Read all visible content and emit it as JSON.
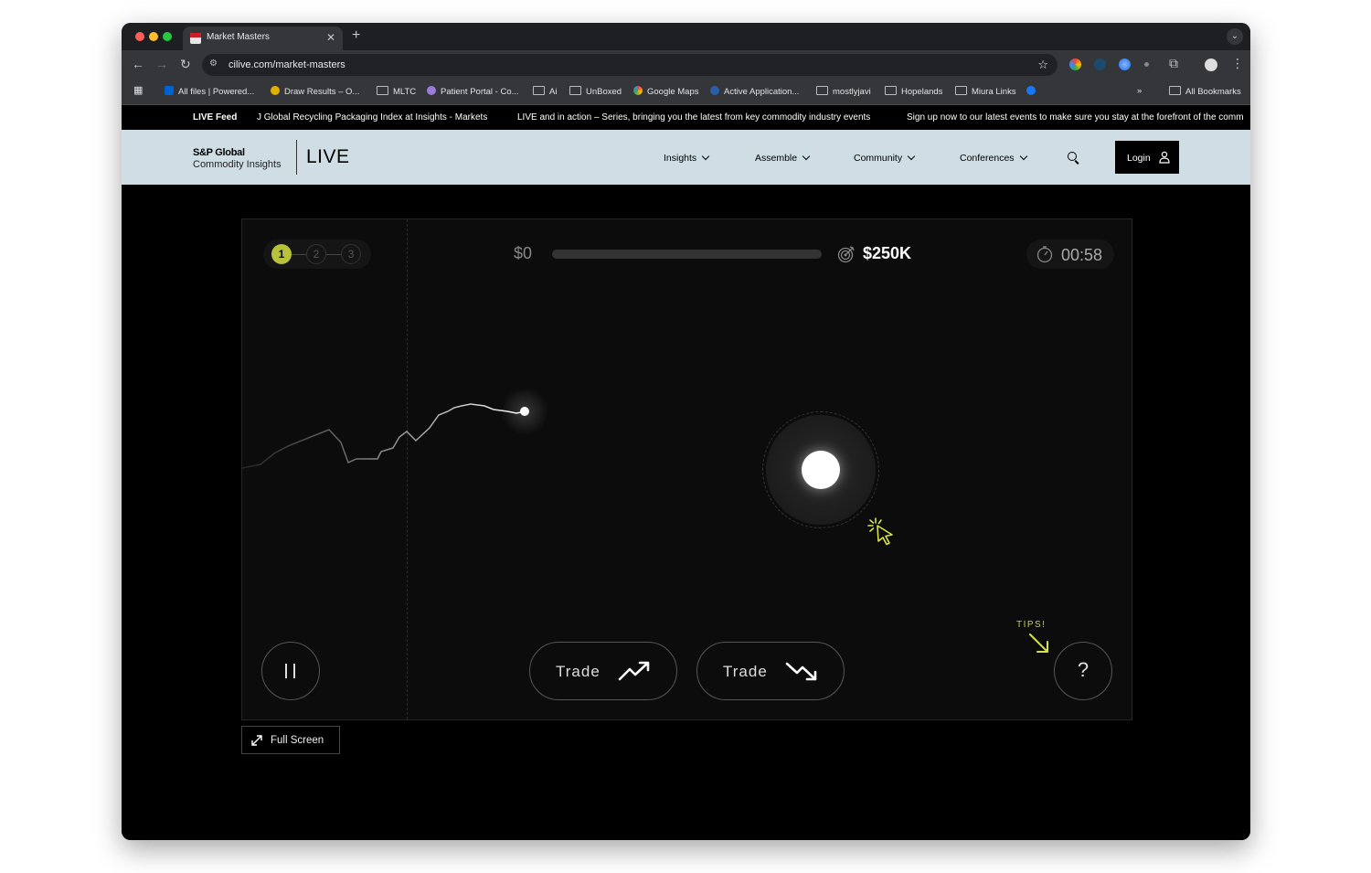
{
  "browser": {
    "tab_title": "Market Masters",
    "url": "cilive.com/market-masters",
    "bookmarks": [
      "All files | Powered...",
      "Draw Results – O...",
      "MLTC",
      "Patient Portal - Co...",
      "Ai",
      "UnBoxed",
      "Google Maps",
      "Active Application...",
      "mostlyjavi",
      "Hopelands",
      "Miura Links"
    ],
    "all_bookmarks": "All Bookmarks",
    "overflow": "»"
  },
  "ticker": {
    "label": "LIVE Feed",
    "items": [
      "J Global Recycling Packaging Index at Insights - Markets",
      "LIVE and in action – Series, bringing you the latest from key commodity industry events",
      "Sign up now to our latest events to make sure you stay at the forefront of the comm"
    ]
  },
  "header": {
    "logo_line1": "S&P Global",
    "logo_line2": "Commodity Insights",
    "logo_live": "LIVE",
    "nav": [
      "Insights",
      "Assemble",
      "Community",
      "Conferences"
    ],
    "login": "Login"
  },
  "game": {
    "steps": [
      "1",
      "2",
      "3"
    ],
    "active_step": 1,
    "money_start": "$0",
    "money_target": "$250K",
    "progress_fraction": 0,
    "timer": "00:58",
    "trade_up_label": "Trade",
    "trade_down_label": "Trade",
    "help_label": "?",
    "tips_label": "TIPS!",
    "fullscreen_label": "Full Screen"
  },
  "colors": {
    "accent": "#b7c23a",
    "header_bg": "#cfdde4"
  }
}
